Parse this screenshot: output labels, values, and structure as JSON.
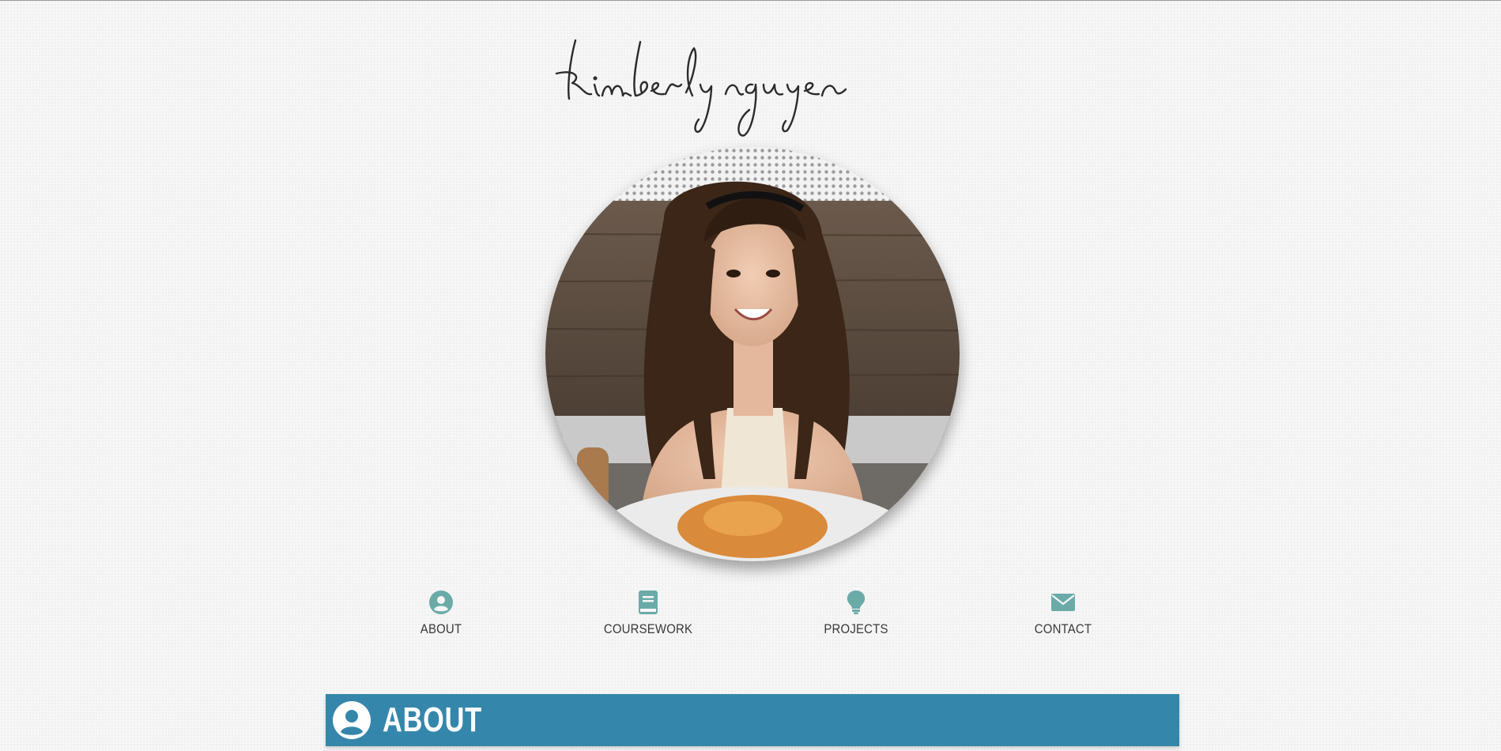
{
  "site": {
    "signature": "kimberly nguyen"
  },
  "nav": {
    "items": [
      {
        "label": "ABOUT",
        "icon": "user-circle-icon"
      },
      {
        "label": "COURSEWORK",
        "icon": "book-icon"
      },
      {
        "label": "PROJECTS",
        "icon": "lightbulb-icon"
      },
      {
        "label": "CONTACT",
        "icon": "envelope-icon"
      }
    ],
    "icon_color": "#6aaba8"
  },
  "section": {
    "title": "ABOUT",
    "icon": "user-circle-icon",
    "color": "#3586ab"
  }
}
